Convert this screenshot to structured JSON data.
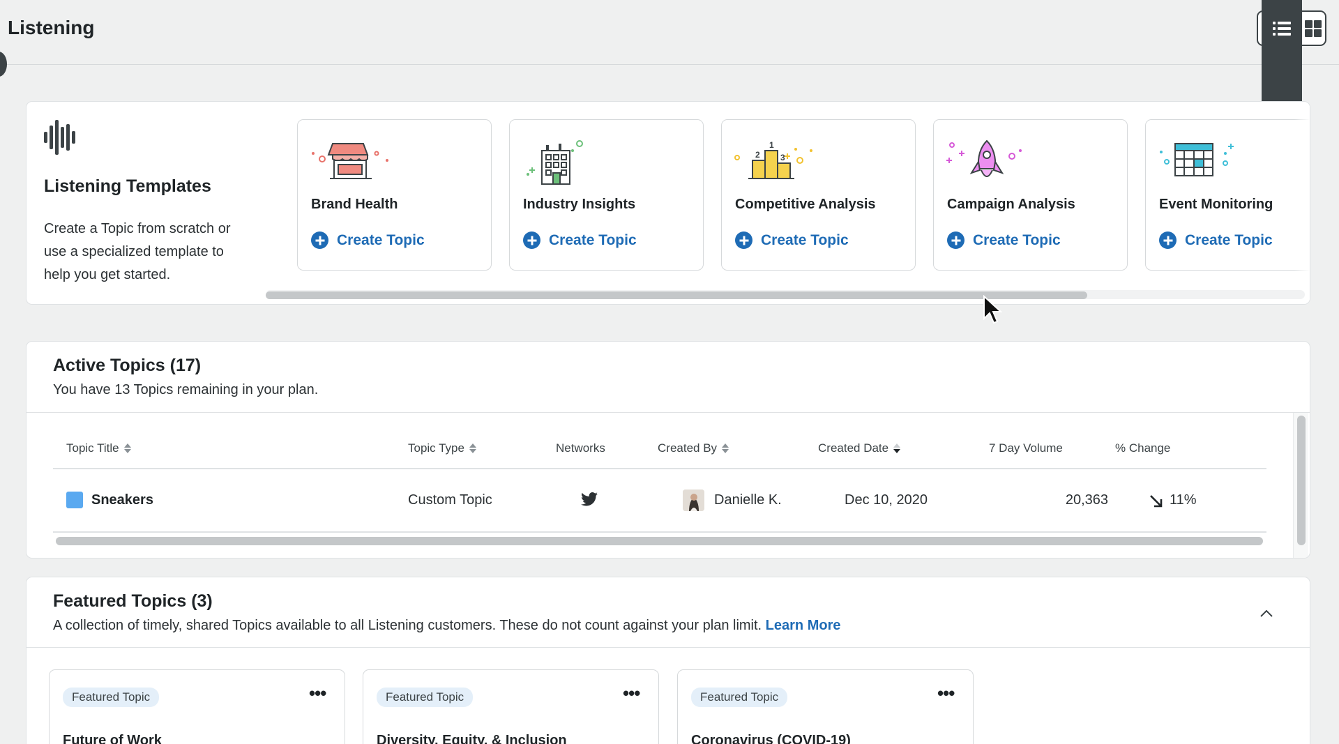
{
  "header": {
    "title": "Listening",
    "view_toggle": [
      "list-view",
      "grid-view"
    ]
  },
  "templates": {
    "title": "Listening Templates",
    "description": "Create a Topic from scratch or use a specialized template to help you get started.",
    "items": [
      {
        "name": "Brand Health",
        "action": "Create Topic",
        "icon": "storefront-icon"
      },
      {
        "name": "Industry Insights",
        "action": "Create Topic",
        "icon": "building-icon"
      },
      {
        "name": "Competitive Analysis",
        "action": "Create Topic",
        "icon": "podium-icon"
      },
      {
        "name": "Campaign Analysis",
        "action": "Create Topic",
        "icon": "rocket-icon"
      },
      {
        "name": "Event Monitoring",
        "action": "Create Topic",
        "icon": "calendar-icon"
      }
    ]
  },
  "active_topics": {
    "title": "Active Topics",
    "count": "(17)",
    "subtitle": "You have 13 Topics remaining in your plan.",
    "columns": [
      "Topic Title",
      "Topic Type",
      "Networks",
      "Created By",
      "Created Date",
      "7 Day Volume",
      "% Change"
    ],
    "rows": [
      {
        "title": "Sneakers",
        "type": "Custom Topic",
        "network": "twitter-icon",
        "created_by": "Danielle K.",
        "created_date": "Dec 10, 2020",
        "volume": "20,363",
        "change": "11%",
        "color": "#5aa9f0"
      }
    ]
  },
  "featured_topics": {
    "title": "Featured Topics",
    "count": "(3)",
    "subtitle": "A collection of timely, shared Topics available to all Listening customers. These do not count against your plan limit.",
    "learn_more": "Learn More",
    "cards": [
      {
        "badge": "Featured Topic",
        "name": "Future of Work"
      },
      {
        "badge": "Featured Topic",
        "name": "Diversity, Equity, & Inclusion"
      },
      {
        "badge": "Featured Topic",
        "name": "Coronavirus (COVID-19)"
      }
    ]
  },
  "colors": {
    "accent": "#1e6bb5",
    "background": "#eff0f0",
    "topic_color": "#5aa9f0"
  }
}
